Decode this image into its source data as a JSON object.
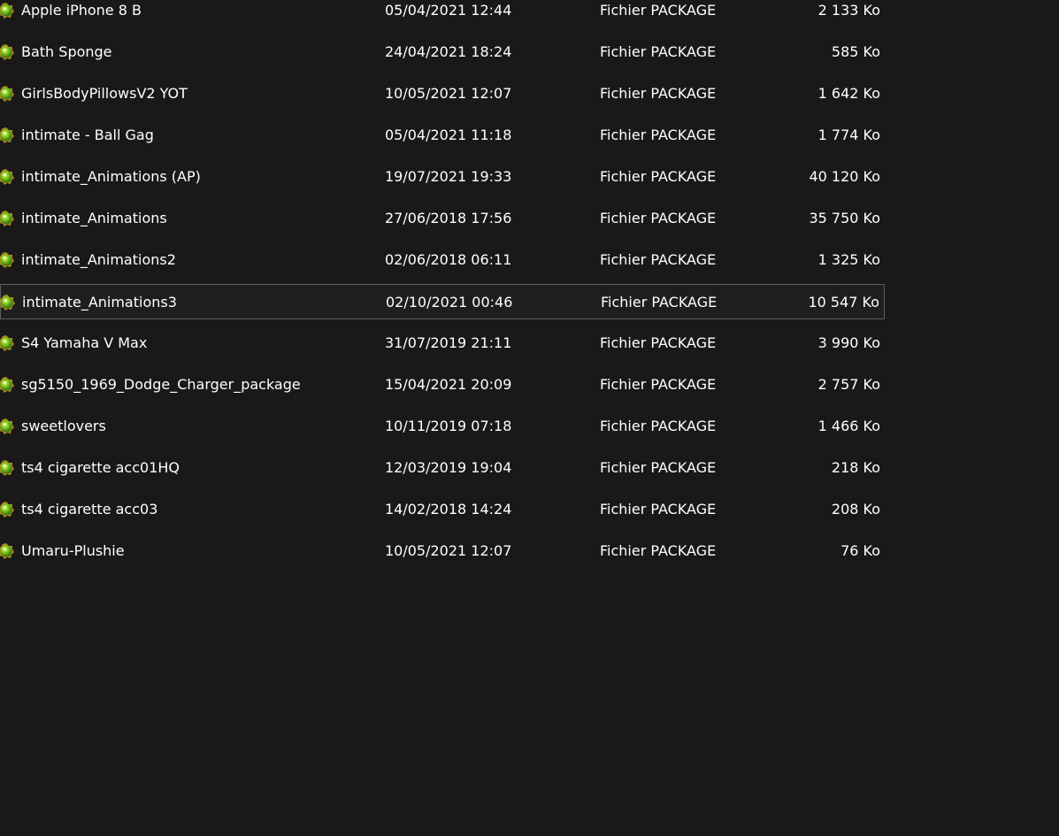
{
  "files": [
    {
      "name": "Apple iPhone 8 B",
      "date": "05/04/2021 12:44",
      "type": "Fichier PACKAGE",
      "size": "2 133 Ko",
      "icon": "package-icon",
      "selected": false
    },
    {
      "name": "Bath Sponge",
      "date": "24/04/2021 18:24",
      "type": "Fichier PACKAGE",
      "size": "585 Ko",
      "icon": "package-icon",
      "selected": false
    },
    {
      "name": "GirlsBodyPillowsV2 YOT",
      "date": "10/05/2021 12:07",
      "type": "Fichier PACKAGE",
      "size": "1 642 Ko",
      "icon": "package-icon",
      "selected": false
    },
    {
      "name": "intimate - Ball Gag",
      "date": "05/04/2021 11:18",
      "type": "Fichier PACKAGE",
      "size": "1 774 Ko",
      "icon": "package-icon",
      "selected": false
    },
    {
      "name": "intimate_Animations (AP)",
      "date": "19/07/2021 19:33",
      "type": "Fichier PACKAGE",
      "size": "40 120 Ko",
      "icon": "package-icon",
      "selected": false
    },
    {
      "name": "intimate_Animations",
      "date": "27/06/2018 17:56",
      "type": "Fichier PACKAGE",
      "size": "35 750 Ko",
      "icon": "package-icon",
      "selected": false
    },
    {
      "name": "intimate_Animations2",
      "date": "02/06/2018 06:11",
      "type": "Fichier PACKAGE",
      "size": "1 325 Ko",
      "icon": "package-icon",
      "selected": false
    },
    {
      "name": "intimate_Animations3",
      "date": "02/10/2021 00:46",
      "type": "Fichier PACKAGE",
      "size": "10 547 Ko",
      "icon": "package-icon",
      "selected": true
    },
    {
      "name": "S4 Yamaha V Max",
      "date": "31/07/2019 21:11",
      "type": "Fichier PACKAGE",
      "size": "3 990 Ko",
      "icon": "package-icon",
      "selected": false
    },
    {
      "name": "sg5150_1969_Dodge_Charger_package",
      "date": "15/04/2021 20:09",
      "type": "Fichier PACKAGE",
      "size": "2 757 Ko",
      "icon": "package-icon",
      "selected": false
    },
    {
      "name": "sweetlovers",
      "date": "10/11/2019 07:18",
      "type": "Fichier PACKAGE",
      "size": "1 466 Ko",
      "icon": "package-icon",
      "selected": false
    },
    {
      "name": "ts4 cigarette acc01HQ",
      "date": "12/03/2019 19:04",
      "type": "Fichier PACKAGE",
      "size": "218 Ko",
      "icon": "package-icon",
      "selected": false
    },
    {
      "name": "ts4 cigarette acc03",
      "date": "14/02/2018 14:24",
      "type": "Fichier PACKAGE",
      "size": "208 Ko",
      "icon": "package-icon",
      "selected": false
    },
    {
      "name": "Umaru-Plushie",
      "date": "10/05/2021 12:07",
      "type": "Fichier PACKAGE",
      "size": "76 Ko",
      "icon": "package-icon",
      "selected": false
    }
  ],
  "colors": {
    "background": "#191919",
    "text": "#ffffff",
    "selection_border": "#5f5f5f",
    "icon_green": "#7cc81e",
    "icon_gold": "#c8a020"
  }
}
